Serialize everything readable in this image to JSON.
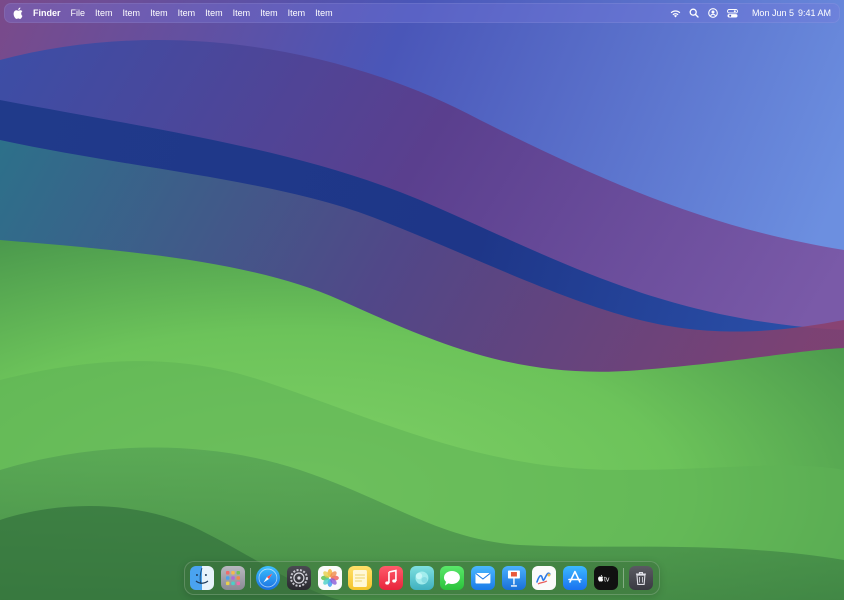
{
  "menubar": {
    "app_name": "Finder",
    "menus": [
      "File",
      "Item",
      "Item",
      "Item",
      "Item",
      "Item",
      "Item",
      "Item",
      "Item",
      "Item"
    ],
    "status_icons": [
      "wifi-icon",
      "search-icon",
      "user-icon",
      "control-center-icon"
    ],
    "date": "Mon Jun 5",
    "time": "9:41 AM"
  },
  "dock": {
    "apps": [
      "finder",
      "launchpad",
      "safari",
      "system-settings",
      "photos",
      "notes",
      "music",
      "freeform-app",
      "messages",
      "mail",
      "keynote",
      "freeform",
      "app-store",
      "apple-tv",
      "trash"
    ],
    "tv_label": "tv"
  },
  "colors": {
    "wallpaper_green": "#6cc35a",
    "wallpaper_blue": "#3b55b8",
    "wallpaper_purple": "#6a4aa0"
  }
}
